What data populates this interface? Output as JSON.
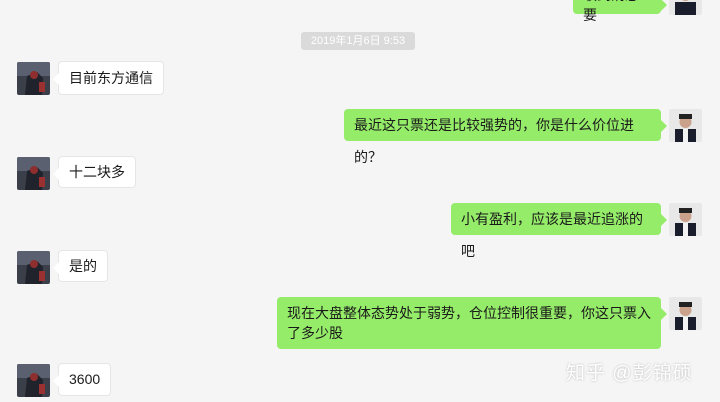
{
  "chat": {
    "timestamp": "2019年1月6日 9:53",
    "top_partial_message": "收到消息要",
    "messages": [
      {
        "side": "left",
        "text": "目前东方通信"
      },
      {
        "side": "right",
        "text": "最近这只票还是比较强势的，你是什么价位进的？"
      },
      {
        "side": "left",
        "text": "十二块多"
      },
      {
        "side": "right",
        "text": "小有盈利，应该是最近追涨的吧"
      },
      {
        "side": "left",
        "text": "是的"
      },
      {
        "side": "right",
        "text": "现在大盘整体态势处于弱势，仓位控制很重要，你这只票入了多少股"
      },
      {
        "side": "left",
        "text": "3600"
      }
    ]
  },
  "watermark": "知乎 @彭锦硕",
  "colors": {
    "background": "#f5f5f5",
    "sent_bubble": "#95ec69",
    "received_bubble": "#ffffff"
  }
}
